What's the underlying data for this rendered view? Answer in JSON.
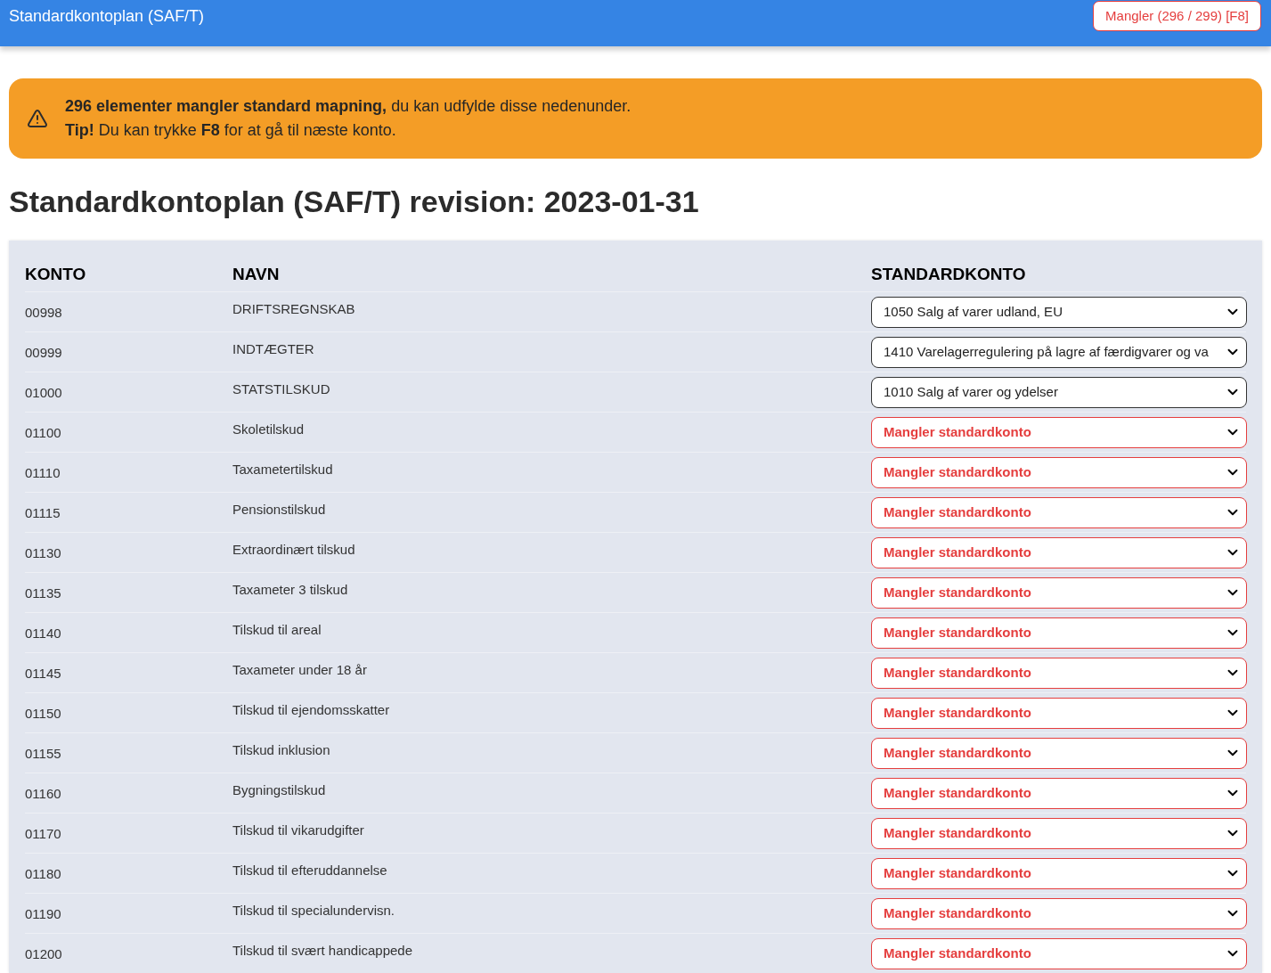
{
  "header": {
    "title": "Standardkontoplan (SAF/T)",
    "missing_button": "Mangler (296 / 299) [F8]"
  },
  "alert": {
    "lines": [
      "**296 elementer mangler standard mapning,** du kan udfylde disse nedenunder.",
      "**Tip!** Du kan trykke **F8** for at gå til næste konto."
    ]
  },
  "heading": "Standardkontoplan (SAF/T) revision: 2023-01-31",
  "table": {
    "columns": [
      "KONTO",
      "NAVN",
      "STANDARDKONTO"
    ],
    "rows": [
      {
        "konto": "00998",
        "navn": "DRIFTSREGNSKAB",
        "standardkonto": {
          "value": "1050 Salg af varer udland, EU",
          "missing": false
        }
      },
      {
        "konto": "00999",
        "navn": "INDTÆGTER",
        "standardkonto": {
          "value": "1410 Varelagerregulering på lagre af færdigvarer og va",
          "missing": false
        }
      },
      {
        "konto": "01000",
        "navn": "STATSTILSKUD",
        "standardkonto": {
          "value": "1010 Salg af varer og ydelser",
          "missing": false
        }
      },
      {
        "konto": "01100",
        "navn": "Skoletilskud",
        "standardkonto": {
          "value": "Mangler standardkonto",
          "missing": true
        }
      },
      {
        "konto": "01110",
        "navn": "Taxametertilskud",
        "standardkonto": {
          "value": "Mangler standardkonto",
          "missing": true
        }
      },
      {
        "konto": "01115",
        "navn": "Pensionstilskud",
        "standardkonto": {
          "value": "Mangler standardkonto",
          "missing": true
        }
      },
      {
        "konto": "01130",
        "navn": "Extraordinært tilskud",
        "standardkonto": {
          "value": "Mangler standardkonto",
          "missing": true
        }
      },
      {
        "konto": "01135",
        "navn": "Taxameter 3 tilskud",
        "standardkonto": {
          "value": "Mangler standardkonto",
          "missing": true
        }
      },
      {
        "konto": "01140",
        "navn": "Tilskud til areal",
        "standardkonto": {
          "value": "Mangler standardkonto",
          "missing": true
        }
      },
      {
        "konto": "01145",
        "navn": "Taxameter under 18 år",
        "standardkonto": {
          "value": "Mangler standardkonto",
          "missing": true
        }
      },
      {
        "konto": "01150",
        "navn": "Tilskud til ejendomsskatter",
        "standardkonto": {
          "value": "Mangler standardkonto",
          "missing": true
        }
      },
      {
        "konto": "01155",
        "navn": "Tilskud inklusion",
        "standardkonto": {
          "value": "Mangler standardkonto",
          "missing": true
        }
      },
      {
        "konto": "01160",
        "navn": "Bygningstilskud",
        "standardkonto": {
          "value": "Mangler standardkonto",
          "missing": true
        }
      },
      {
        "konto": "01170",
        "navn": "Tilskud til vikarudgifter",
        "standardkonto": {
          "value": "Mangler standardkonto",
          "missing": true
        }
      },
      {
        "konto": "01180",
        "navn": "Tilskud til efteruddannelse",
        "standardkonto": {
          "value": "Mangler standardkonto",
          "missing": true
        }
      },
      {
        "konto": "01190",
        "navn": "Tilskud til specialundervisn.",
        "standardkonto": {
          "value": "Mangler standardkonto",
          "missing": true
        }
      },
      {
        "konto": "01200",
        "navn": "Tilskud til svært handicappede",
        "standardkonto": {
          "value": "Mangler standardkonto",
          "missing": true
        }
      }
    ]
  }
}
